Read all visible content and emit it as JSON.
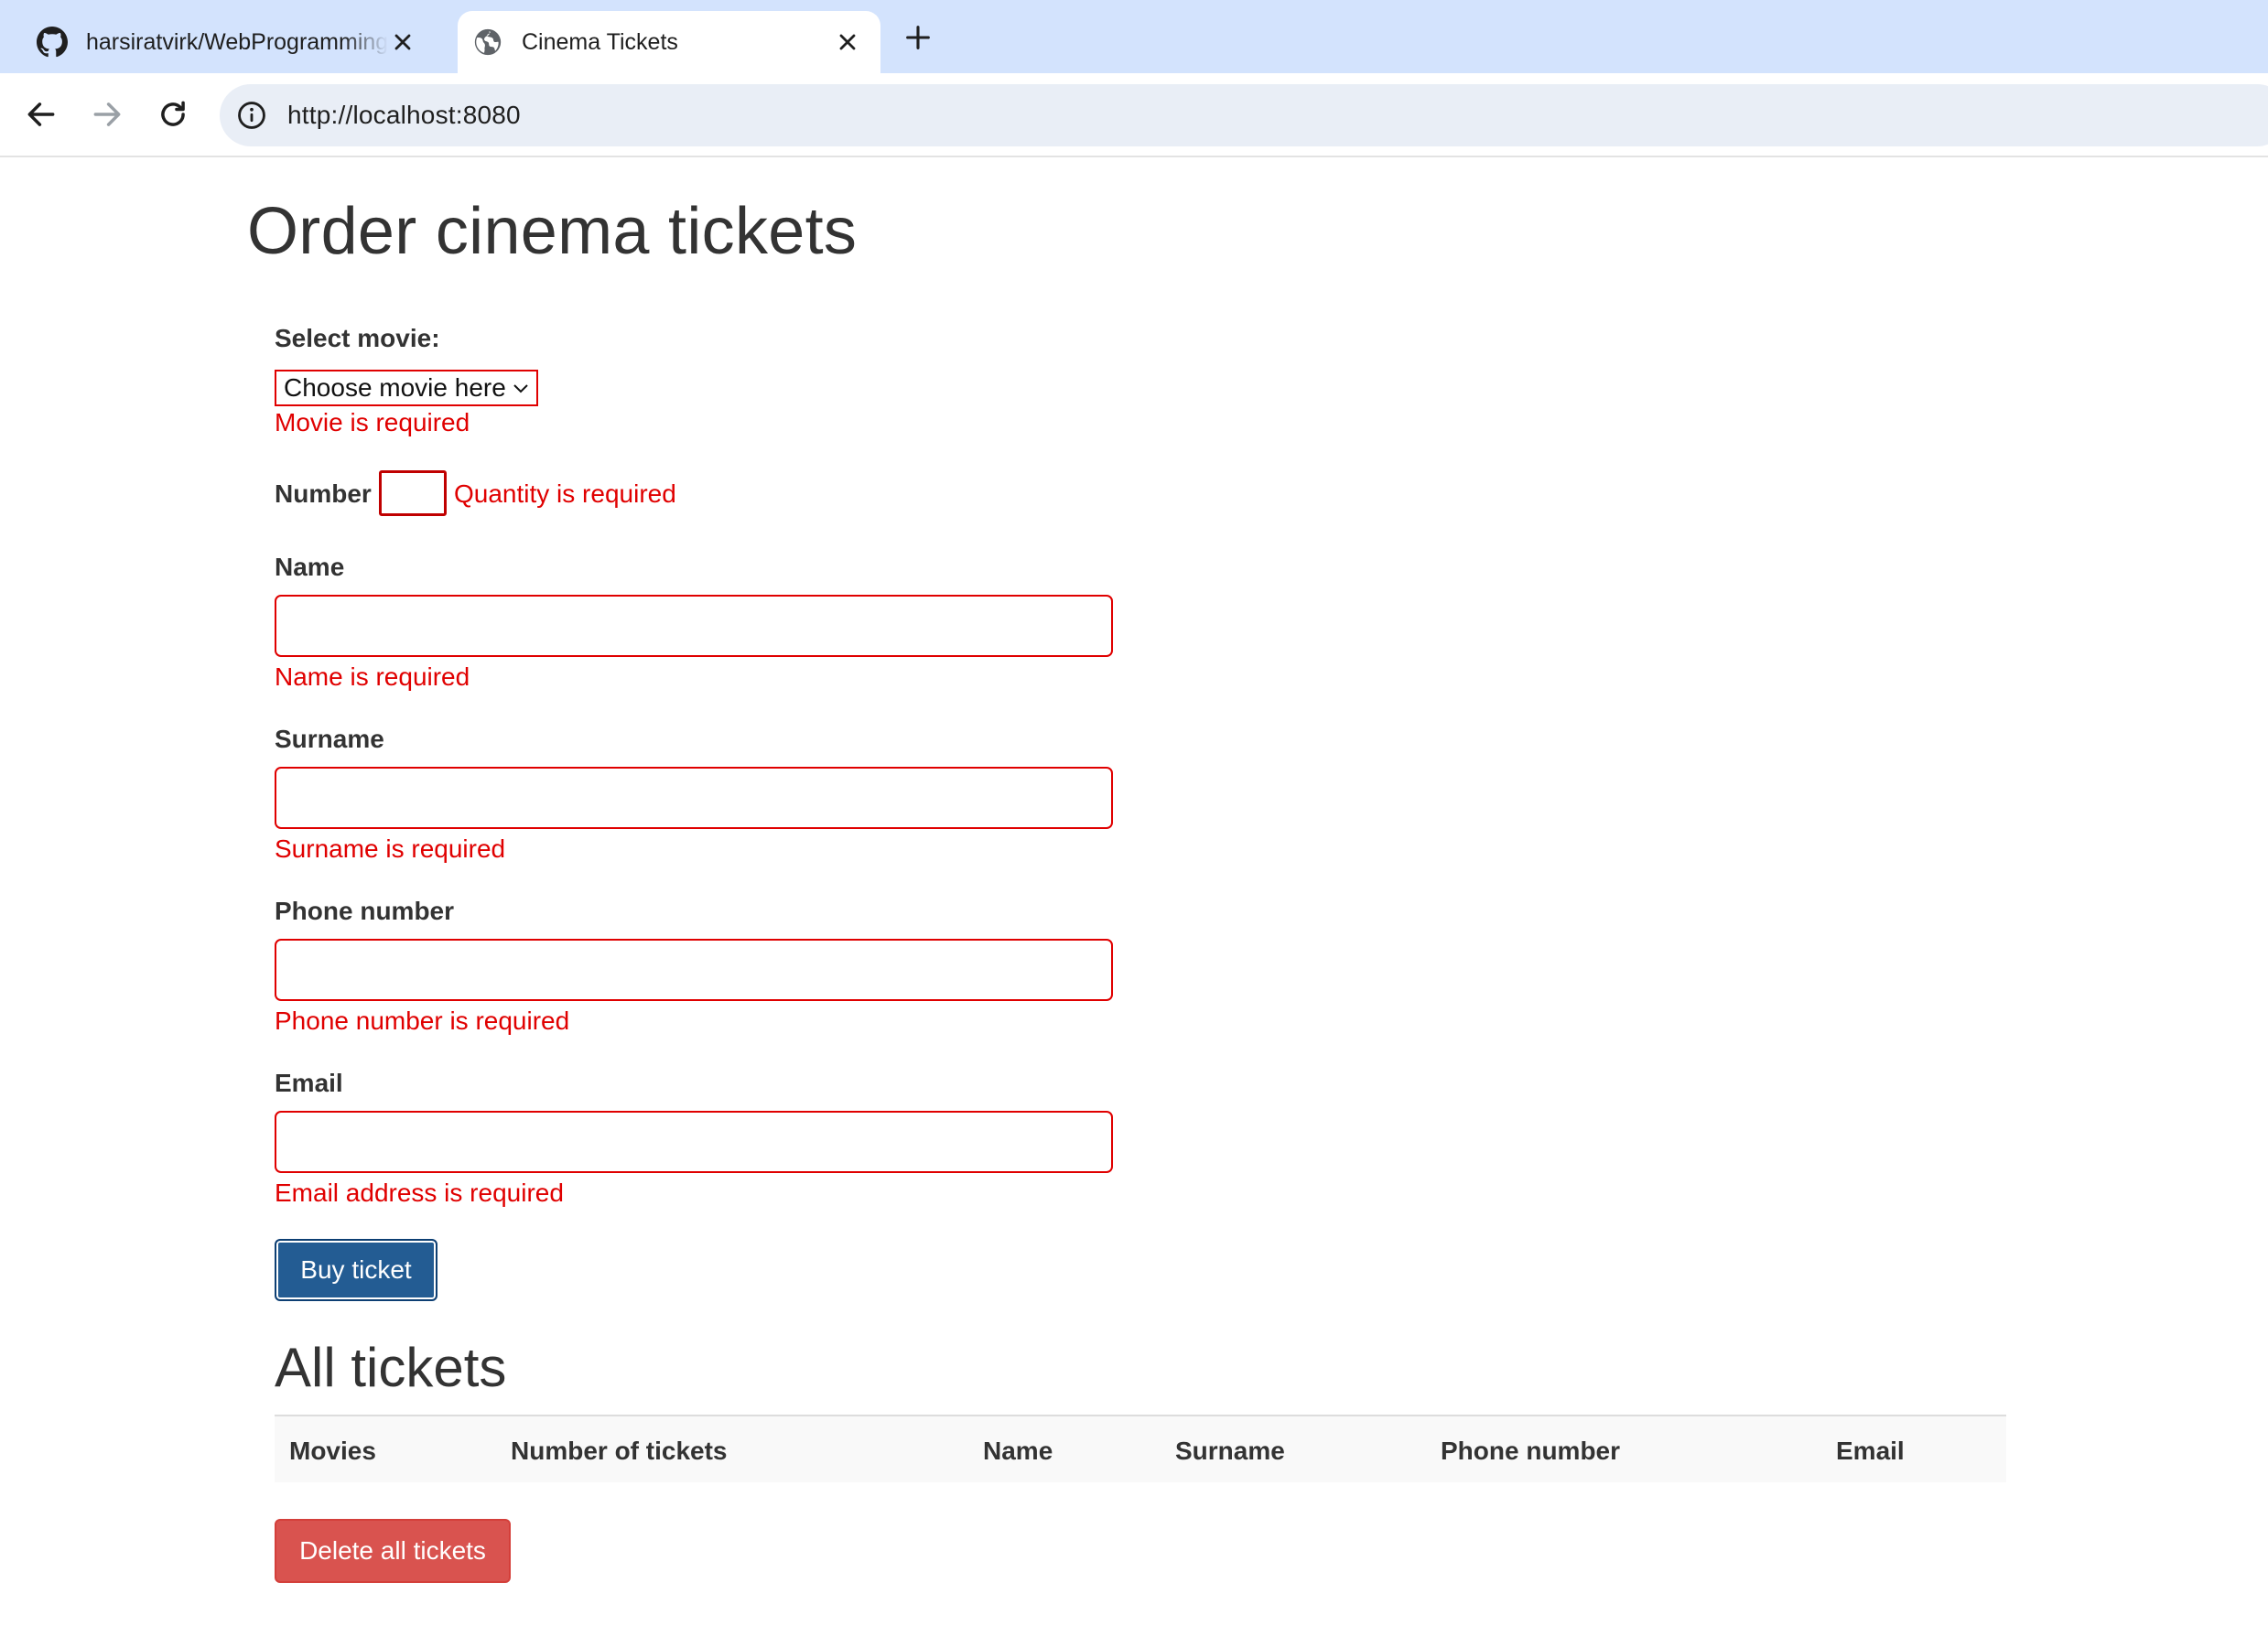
{
  "browser": {
    "tabs": [
      {
        "title": "harsiratvirk/WebProgramming",
        "icon": "github-icon",
        "active": false
      },
      {
        "title": "Cinema Tickets",
        "icon": "globe-icon",
        "active": true
      }
    ],
    "url": "http://localhost:8080"
  },
  "page": {
    "title": "Order cinema tickets",
    "form": {
      "movie": {
        "label": "Select movie:",
        "selected": "Choose movie here",
        "error": "Movie is required"
      },
      "quantity": {
        "label": "Number",
        "value": "",
        "error": "Quantity is required"
      },
      "name": {
        "label": "Name",
        "value": "",
        "error": "Name is required"
      },
      "surname": {
        "label": "Surname",
        "value": "",
        "error": "Surname is required"
      },
      "phone": {
        "label": "Phone number",
        "value": "",
        "error": "Phone number is required"
      },
      "email": {
        "label": "Email",
        "value": "",
        "error": "Email address is required"
      },
      "submit_label": "Buy ticket"
    },
    "tickets": {
      "title": "All tickets",
      "columns": [
        "Movies",
        "Number of tickets",
        "Name",
        "Surname",
        "Phone number",
        "Email"
      ],
      "rows": [],
      "delete_label": "Delete all tickets"
    }
  },
  "colors": {
    "error": "#e00000",
    "primary_button": "#235c93",
    "danger_button": "#d9534f",
    "tabstrip": "#d3e3fd"
  }
}
